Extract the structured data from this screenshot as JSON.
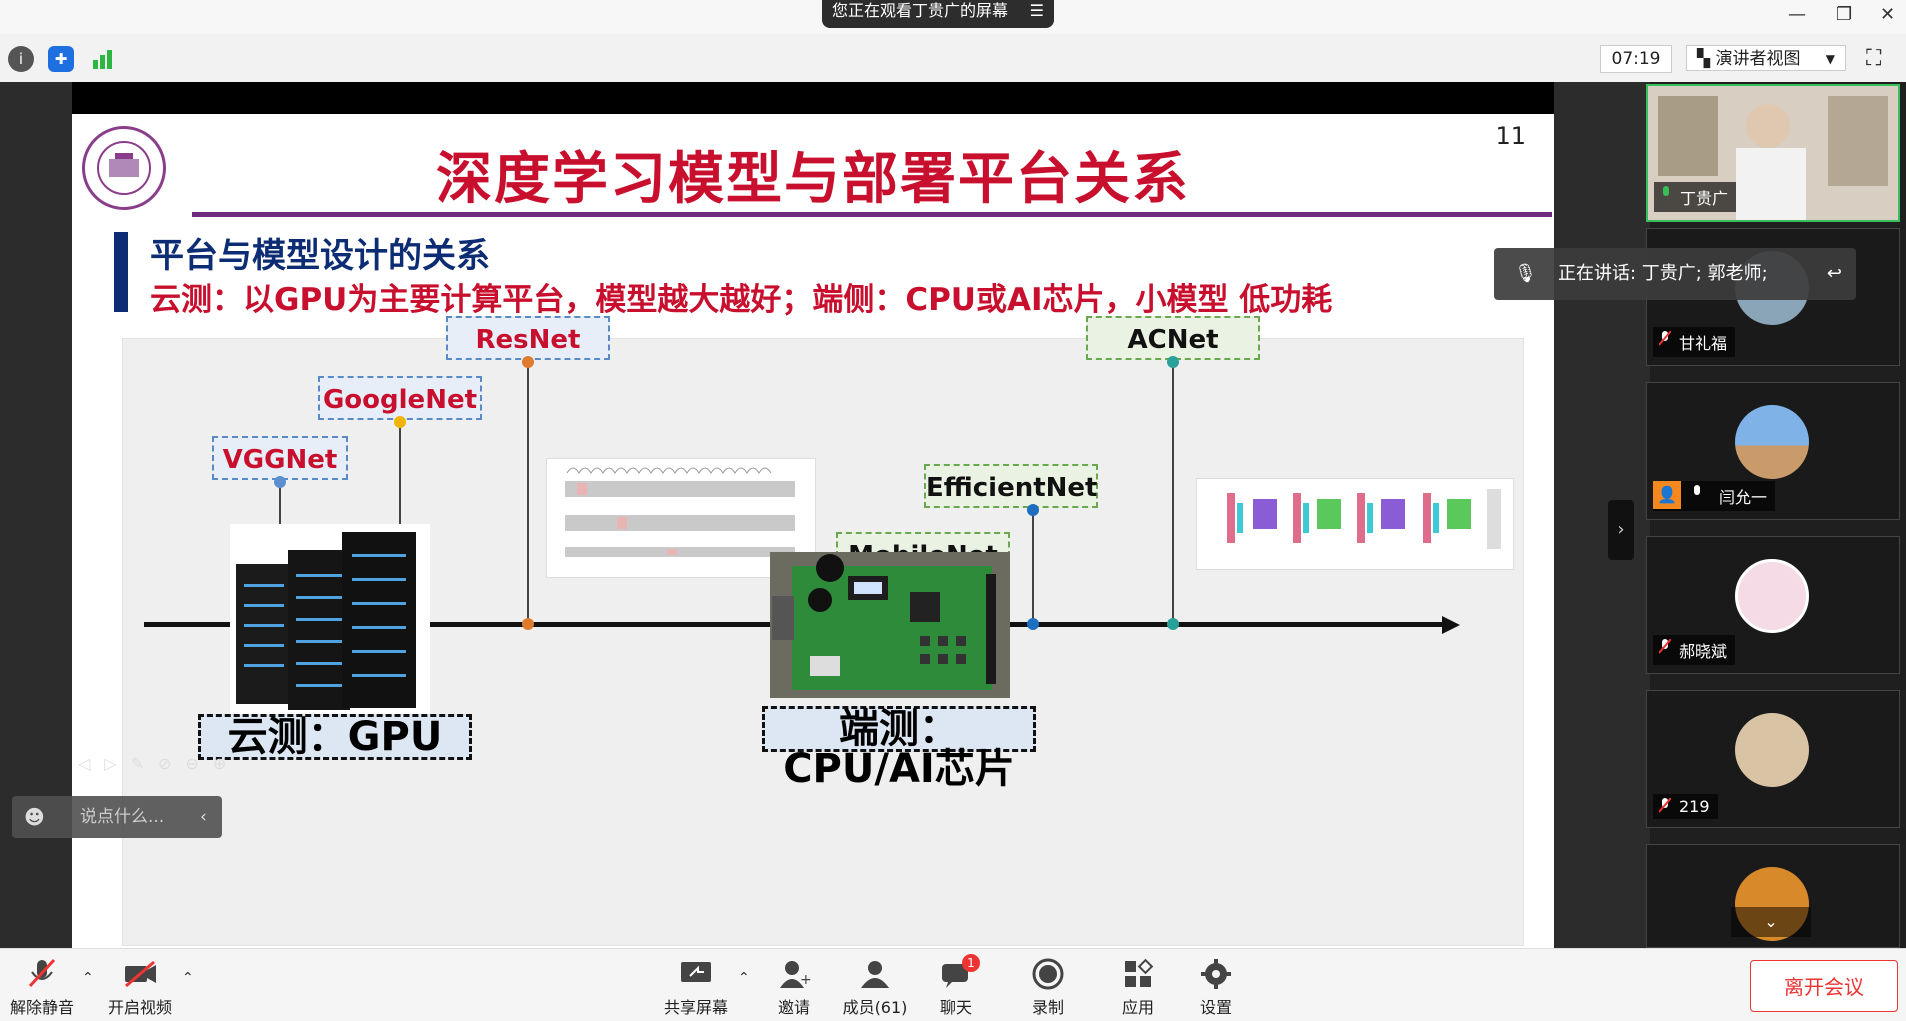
{
  "window": {
    "share_notice": "您正在观看丁贵广的屏幕",
    "menu_icon": "menu-icon"
  },
  "toolbar": {
    "timer": "07:19",
    "view_mode": "演讲者视图"
  },
  "slide": {
    "title": "深度学习模型与部署平台关系",
    "page_number": "11",
    "logo_text": "TSINGHUA UNIVERSITY",
    "subtitle": "平台与模型设计的关系",
    "subtitle2": "云测：以GPU为主要计算平台，模型越大越好；端侧：CPU或AI芯片，小模型 低功耗",
    "models": [
      {
        "name": "VGGNet"
      },
      {
        "name": "GoogleNet"
      },
      {
        "name": "ResNet"
      },
      {
        "name": "MobileNet"
      },
      {
        "name": "EfficientNet"
      },
      {
        "name": "ACNet"
      }
    ],
    "cloud_label": "云测：GPU",
    "edge_label": "端测：CPU/AI芯片",
    "colors": {
      "title": "#c8102e",
      "sub": "#0c2d74",
      "accent_line": "#6b2a7a"
    }
  },
  "participants": {
    "speaking_text": "正在讲话: 丁贵广; 郭老师;",
    "tiles": [
      {
        "name": "丁贵广"
      },
      {
        "name": "甘礼福"
      },
      {
        "name": "闫允一"
      },
      {
        "name": "郝晓斌"
      },
      {
        "name": "219"
      },
      {
        "name": ""
      }
    ]
  },
  "chat_input": {
    "placeholder": "说点什么..."
  },
  "bottom_bar": {
    "unmute": "解除静音",
    "start_video": "开启视频",
    "share_screen": "共享屏幕",
    "invite": "邀请",
    "members": "成员(61)",
    "chat": "聊天",
    "chat_badge": "1",
    "record": "录制",
    "apps": "应用",
    "settings": "设置",
    "leave": "离开会议"
  }
}
